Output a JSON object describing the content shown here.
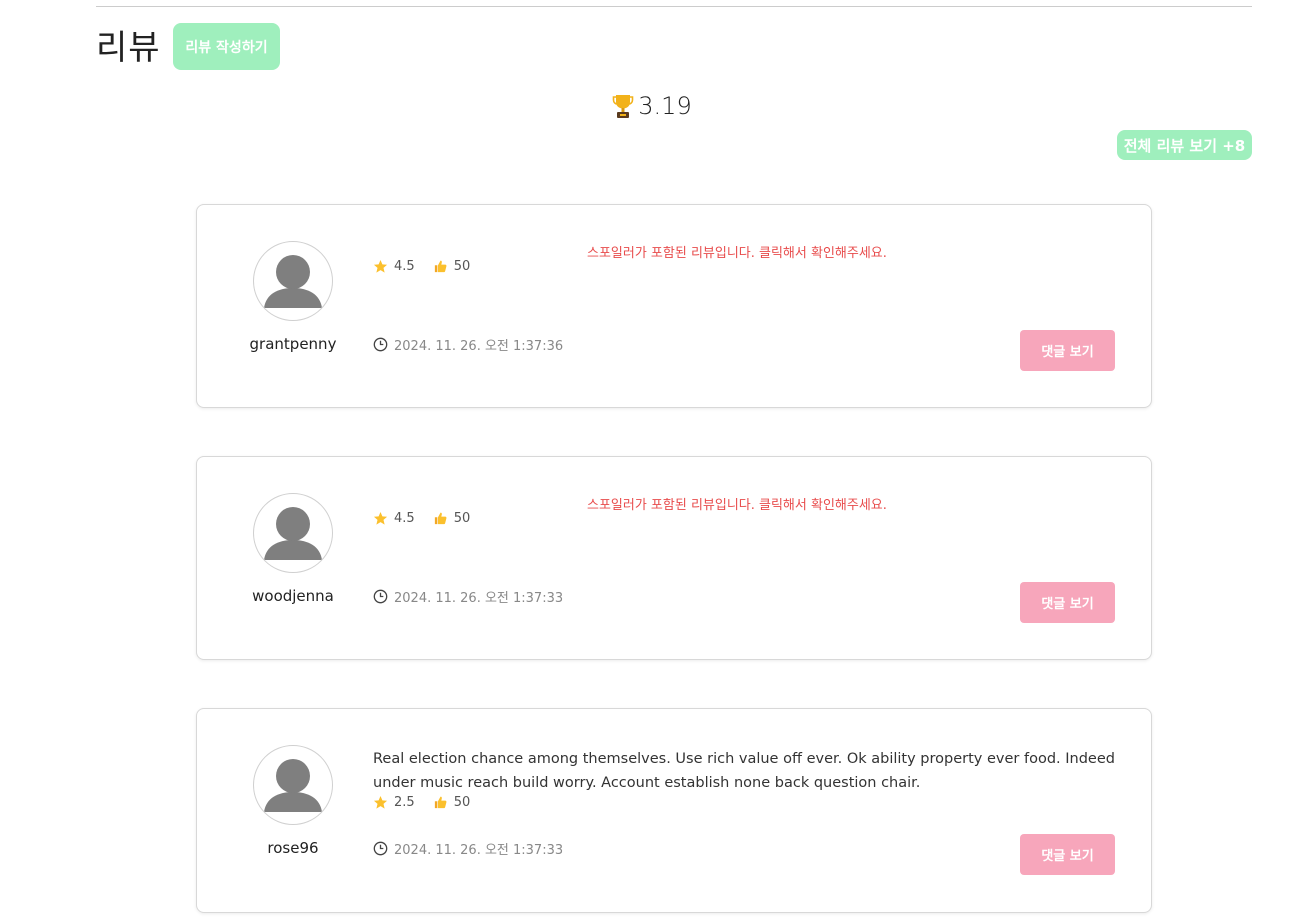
{
  "header": {
    "title": "리뷰",
    "write_button": "리뷰 작성하기",
    "average_rating": "3.19",
    "all_reviews_button": "전체 리뷰 보기 +8"
  },
  "colors": {
    "green_button": "#9fefbd",
    "pink_button": "#f7a6bb",
    "spoiler_red": "#e84c4c"
  },
  "icons": {
    "rating": "trophy-icon",
    "score": "star-icon",
    "likes": "thumbs-up-icon",
    "date": "clock-icon",
    "avatar": "user-icon"
  },
  "reviews": [
    {
      "username": "grantpenny",
      "spoiler_notice": "스포일러가 포함된 리뷰입니다. 클릭해서 확인해주세요.",
      "text": "",
      "rating": "4.5",
      "likes": "50",
      "date": "2024. 11. 26. 오전 1:37:36",
      "comment_button": "댓글 보기"
    },
    {
      "username": "woodjenna",
      "spoiler_notice": "스포일러가 포함된 리뷰입니다. 클릭해서 확인해주세요.",
      "text": "",
      "rating": "4.5",
      "likes": "50",
      "date": "2024. 11. 26. 오전 1:37:33",
      "comment_button": "댓글 보기"
    },
    {
      "username": "rose96",
      "spoiler_notice": "",
      "text": "Real election chance among themselves. Use rich value off ever. Ok ability property ever food. Indeed under music reach build worry. Account establish none back question chair.",
      "rating": "2.5",
      "likes": "50",
      "date": "2024. 11. 26. 오전 1:37:33",
      "comment_button": "댓글 보기"
    }
  ]
}
